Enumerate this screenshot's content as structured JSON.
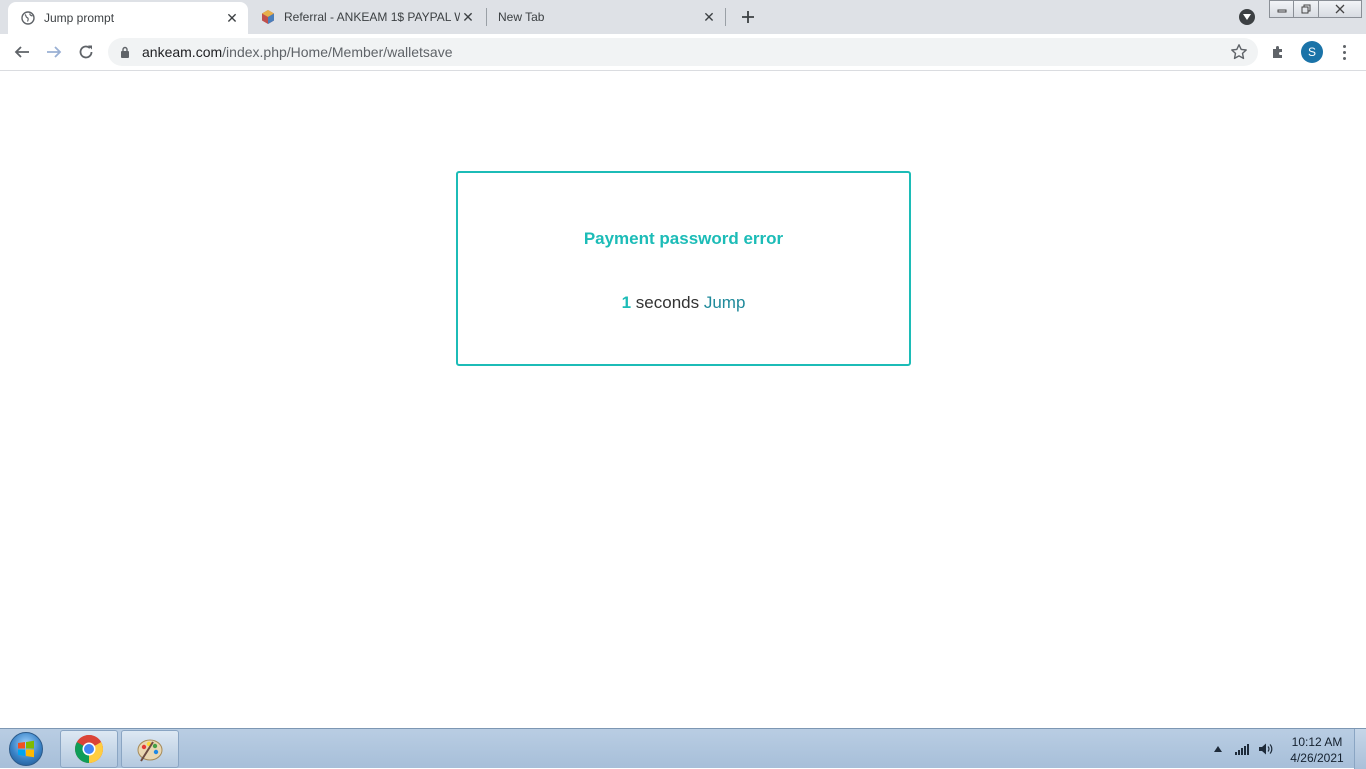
{
  "browser": {
    "tabs": [
      {
        "title": "Jump prompt",
        "active": true,
        "favicon": "globe-icon"
      },
      {
        "title": "Referral - ANKEAM 1$ PAYPAL W",
        "active": false,
        "favicon": "ankeam-logo-icon"
      },
      {
        "title": "New Tab",
        "active": false,
        "favicon": ""
      }
    ],
    "url": {
      "host": "ankeam.com",
      "path": "/index.php/Home/Member/walletsave"
    },
    "profile_initial": "S"
  },
  "page": {
    "message": "Payment password error",
    "countdown": "1",
    "countdown_suffix": " seconds ",
    "jump_label": "Jump"
  },
  "taskbar": {
    "time": "10:12 AM",
    "date": "4/26/2021"
  },
  "colors": {
    "accent": "#1cbcb7",
    "jump_link": "#1f8a9b",
    "taskbar": "#a7bfd9"
  }
}
